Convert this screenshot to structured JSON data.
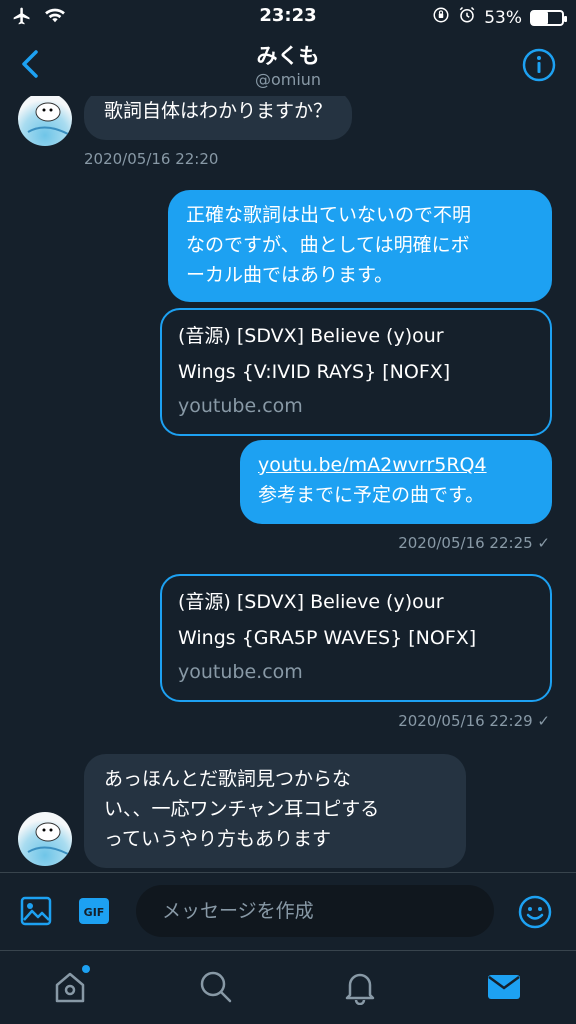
{
  "status_bar": {
    "time": "23:23",
    "battery": "53%",
    "battery_level": 0.53
  },
  "header": {
    "name": "みくも",
    "handle": "@omiun"
  },
  "messages": {
    "m1": {
      "text": "歌詞自体はわかりますか？"
    },
    "ts1": "2020/05/16 22:20",
    "m2": {
      "lines": [
        "正確な歌詞は出ていないので不明",
        "なのですが、曲としては明確にボ",
        "ーカル曲ではあります。"
      ]
    },
    "card1": {
      "title_lines": [
        "(音源) [SDVX] Believe (y)our",
        "Wings {V:IVID RAYS} [NOFX]"
      ],
      "domain": "youtube.com"
    },
    "m3": {
      "link": "youtu.be/mA2wvrr5RQ4",
      "text": "参考までに予定の曲です。"
    },
    "ts2": "2020/05/16 22:25 ✓",
    "card2": {
      "title_lines": [
        "(音源) [SDVX] Believe (y)our",
        "Wings {GRA5P WAVES} [NOFX]"
      ],
      "domain": "youtube.com"
    },
    "ts3": "2020/05/16 22:29 ✓",
    "m4": {
      "lines": [
        "あっほんとだ歌詞見つからな",
        "い、、一応ワンチャン耳コピする",
        "っていうやり方もあります"
      ]
    }
  },
  "compose": {
    "placeholder": "メッセージを作成",
    "gif_label": "GIF"
  },
  "colors": {
    "background": "#15202b",
    "accent": "#1da1f2",
    "incoming_bubble": "#253341",
    "muted_text": "#8899a6"
  },
  "icons": {
    "airplane": "airplane-icon",
    "wifi": "wifi-icon",
    "rotation_lock": "rotation-lock-icon",
    "alarm": "alarm-icon",
    "back": "chevron-left-icon",
    "info": "info-icon",
    "media": "image-icon",
    "gif": "gif-icon",
    "emoji": "emoji-icon",
    "home": "home-icon",
    "search": "search-icon",
    "notifications": "bell-icon",
    "messages": "mail-icon"
  }
}
